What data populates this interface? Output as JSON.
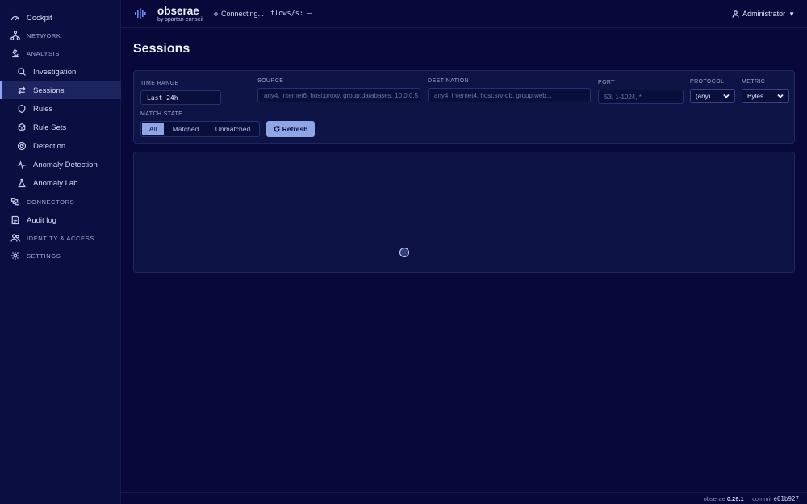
{
  "sidebar": {
    "cockpit": "Cockpit",
    "network": "NETWORK",
    "analysis": "ANALYSIS",
    "investigation": "Investigation",
    "sessions": "Sessions",
    "rules": "Rules",
    "rule_sets": "Rule Sets",
    "detection": "Detection",
    "anomaly_detection": "Anomaly Detection",
    "anomaly_lab": "Anomaly Lab",
    "connectors": "CONNECTORS",
    "audit_log": "Audit log",
    "identity_access": "IDENTITY & ACCESS",
    "settings": "SETTINGS"
  },
  "header": {
    "brand": "obserae",
    "brand_sub": "by spartan-conseil",
    "connection_status": "Connecting...",
    "flows_label": "flows/s: —",
    "user_name": "Administrator"
  },
  "page": {
    "title": "Sessions"
  },
  "filters": {
    "time_range_label": "TIME RANGE",
    "time_range_value": "Last 24h",
    "source_label": "SOURCE",
    "source_placeholder": "any4, internet6, host:proxy, group:databases, 10.0.0.5",
    "destination_label": "DESTINATION",
    "destination_placeholder": "any4, internet4, host:srv-db, group:web...",
    "port_label": "PORT",
    "port_placeholder": "53, 1-1024, *",
    "protocol_label": "PROTOCOL",
    "protocol_value": "(any)",
    "metric_label": "METRIC",
    "metric_value": "Bytes",
    "match_state_label": "MATCH STATE",
    "match_all": "All",
    "match_matched": "Matched",
    "match_unmatched": "Unmatched",
    "refresh_label": "Refresh"
  },
  "footer": {
    "app_name": "obserae",
    "version": "0.29.1",
    "commit_label": "commit",
    "commit_hash": "e01b927"
  },
  "colors": {
    "background": "#08093a",
    "accent": "#8fa6e6"
  }
}
